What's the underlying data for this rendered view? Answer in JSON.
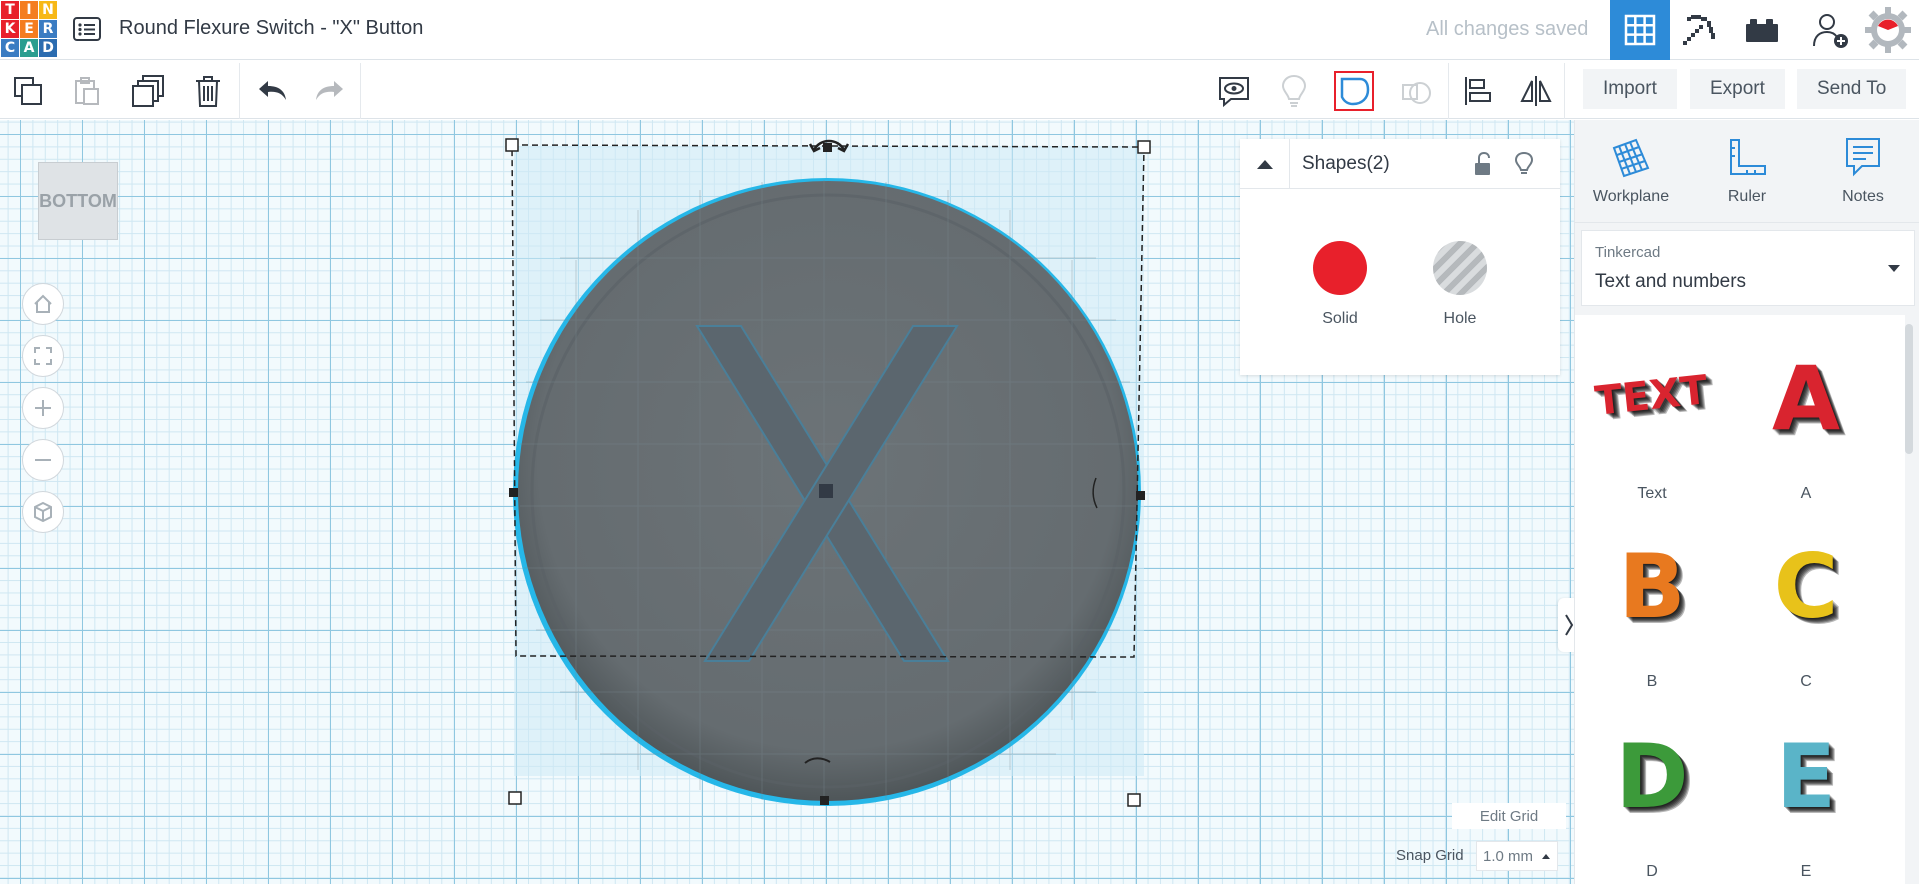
{
  "app": {
    "logo_letters": [
      "T",
      "I",
      "N",
      "K",
      "E",
      "R",
      "C",
      "A",
      "D"
    ],
    "logo_colors": [
      "#e8202b",
      "#f47d20",
      "#f7b817",
      "#e8202b",
      "#f47d20",
      "#3a7cc2",
      "#3a7cc2",
      "#2a9d8f",
      "#2b6cb0"
    ],
    "design_title": "Round Flexure Switch - \"X\" Button",
    "save_status": "All changes saved",
    "accent_color": "#2d8bd8"
  },
  "topbar": {
    "icons": [
      "design-list-icon",
      "grid-view-icon",
      "pickaxe-icon",
      "bricks-icon",
      "add-user-icon",
      "profile-gear-icon"
    ]
  },
  "toolbar": {
    "import_label": "Import",
    "export_label": "Export",
    "send_to_label": "Send To"
  },
  "workspace": {
    "view_cube_face": "BOTTOM",
    "edit_grid_label": "Edit Grid",
    "snap_grid_label": "Snap Grid",
    "snap_grid_value": "1.0 mm",
    "selected_shape_letter": "X"
  },
  "inspector": {
    "title": "Shapes(2)",
    "solid_label": "Solid",
    "hole_label": "Hole",
    "solid_color": "#e8202b"
  },
  "rightpanel": {
    "tools": [
      {
        "label": "Workplane",
        "icon": "workplane-icon"
      },
      {
        "label": "Ruler",
        "icon": "ruler-icon"
      },
      {
        "label": "Notes",
        "icon": "notes-icon"
      }
    ],
    "category_library": "Tinkercad",
    "category_name": "Text and numbers",
    "shapes": [
      {
        "label": "Text",
        "color": "#d9242f",
        "glyph": "TEXT"
      },
      {
        "label": "A",
        "color": "#d9242f",
        "glyph": "A"
      },
      {
        "label": "B",
        "color": "#e8791f",
        "glyph": "B"
      },
      {
        "label": "C",
        "color": "#e8c21a",
        "glyph": "C"
      },
      {
        "label": "D",
        "color": "#3c9a3a",
        "glyph": "D"
      },
      {
        "label": "E",
        "color": "#5ab4c8",
        "glyph": "E"
      }
    ]
  }
}
